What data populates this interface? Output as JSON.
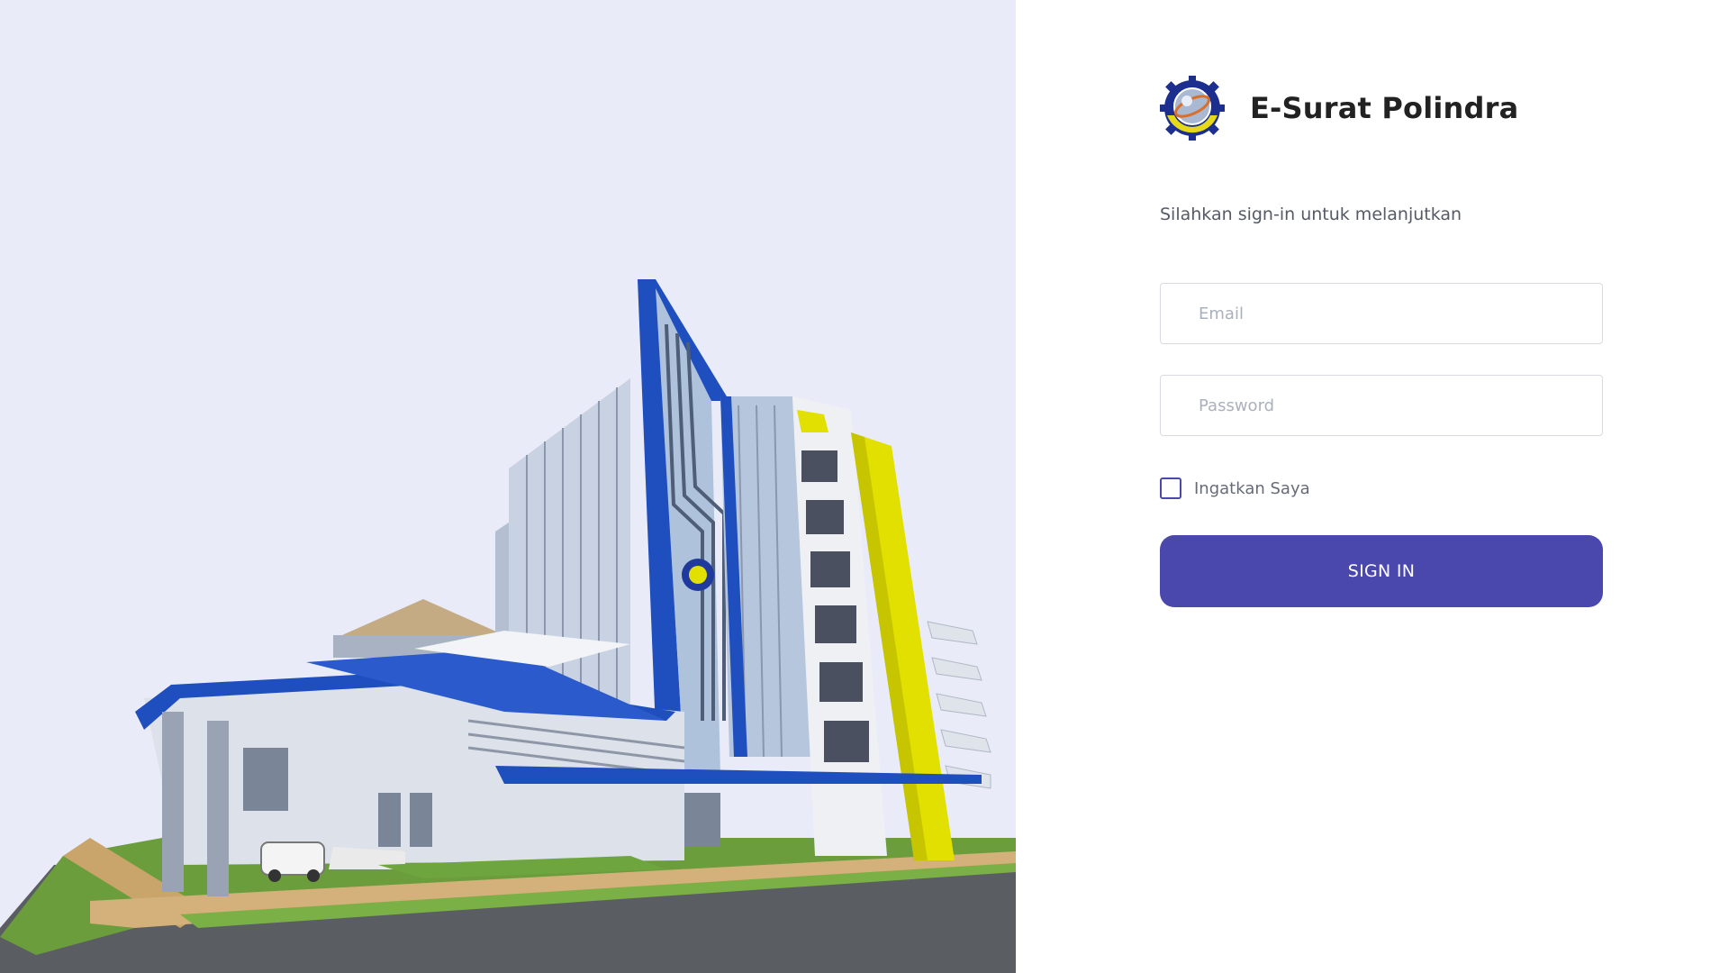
{
  "brand": {
    "title": "E-Surat Polindra",
    "logo_icon": "polindra-logo-icon"
  },
  "form": {
    "subtitle": "Silahkan sign-in untuk melanjutkan",
    "email_placeholder": "Email",
    "email_value": "",
    "password_placeholder": "Password",
    "password_value": "",
    "remember_label": "Ingatkan Saya",
    "remember_checked": false,
    "signin_label": "SIGN IN"
  },
  "colors": {
    "accent": "#4a47ad",
    "hero_background": "#e9ecf8",
    "building_blue": "#1f4fbf",
    "building_yellow": "#e2e000"
  },
  "hero": {
    "icon": "campus-building-illustration"
  }
}
